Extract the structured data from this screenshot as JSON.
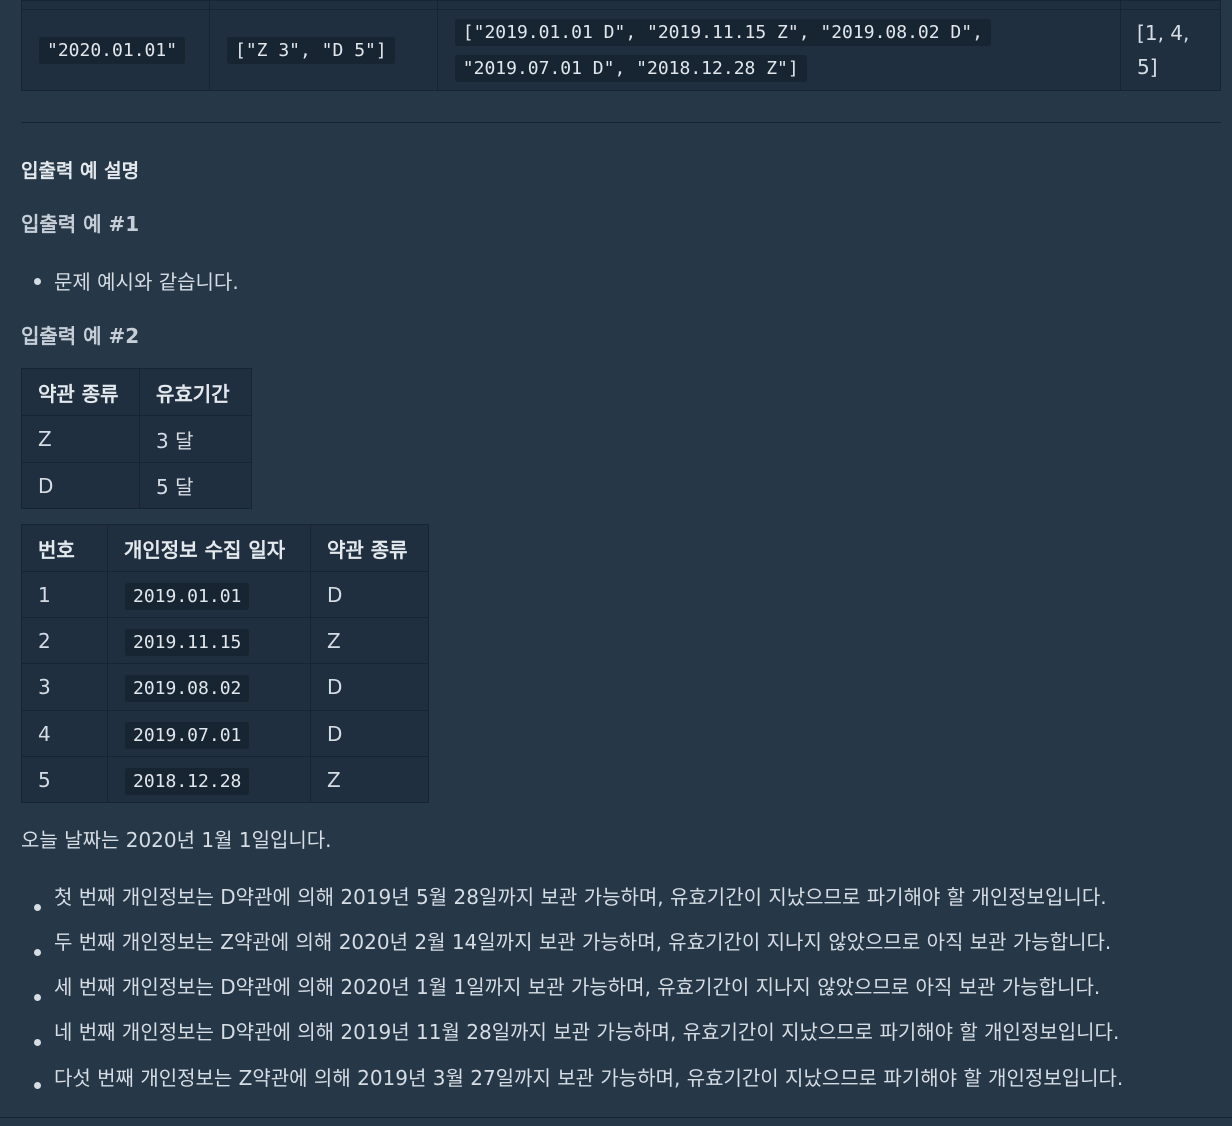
{
  "top_table": {
    "date": "\"2020.01.01\"",
    "terms": "[\"Z 3\", \"D 5\"]",
    "privacies": [
      "[\"2019.01.01 D\", \"2019.11.15 Z\", \"2019.08.02 D\",",
      "\"2019.07.01 D\", \"2018.12.28 Z\"]"
    ],
    "result_lines": [
      "[1, 4,",
      "5]"
    ]
  },
  "section": {
    "title": "입출력 예 설명",
    "example1": {
      "heading": "입출력 예 #1",
      "bullets": [
        "문제 예시와 같습니다."
      ]
    },
    "example2": {
      "heading": "입출력 예 #2",
      "terms_table": {
        "headers": [
          "약관 종류",
          "유효기간"
        ],
        "rows": [
          [
            "Z",
            "3 달"
          ],
          [
            "D",
            "5 달"
          ]
        ]
      },
      "privacy_table": {
        "headers": [
          "번호",
          "개인정보 수집 일자",
          "약관 종류"
        ],
        "rows": [
          [
            "1",
            "2019.01.01",
            "D"
          ],
          [
            "2",
            "2019.11.15",
            "Z"
          ],
          [
            "3",
            "2019.08.02",
            "D"
          ],
          [
            "4",
            "2019.07.01",
            "D"
          ],
          [
            "5",
            "2018.12.28",
            "Z"
          ]
        ]
      },
      "today_text": "오늘 날짜는 2020년 1월 1일입니다.",
      "bullets": [
        "첫 번째 개인정보는 D약관에 의해 2019년 5월 28일까지 보관 가능하며, 유효기간이 지났으므로 파기해야 할 개인정보입니다.",
        "두 번째 개인정보는 Z약관에 의해 2020년 2월 14일까지 보관 가능하며, 유효기간이 지나지 않았으므로 아직 보관 가능합니다.",
        "세 번째 개인정보는 D약관에 의해 2020년 1월 1일까지 보관 가능하며, 유효기간이 지나지 않았으므로 아직 보관 가능합니다.",
        "네 번째 개인정보는 D약관에 의해 2019년 11월 28일까지 보관 가능하며, 유효기간이 지났으므로 파기해야 할 개인정보입니다.",
        "다섯 번째 개인정보는 Z약관에 의해 2019년 3월 27일까지 보관 가능하며, 유효기간이 지났으므로 파기해야 할 개인정보입니다."
      ]
    }
  },
  "colors": {
    "background": "#263747",
    "table_cell": "#202f3f",
    "code_bg": "#172532",
    "text": "#d6dce4"
  }
}
